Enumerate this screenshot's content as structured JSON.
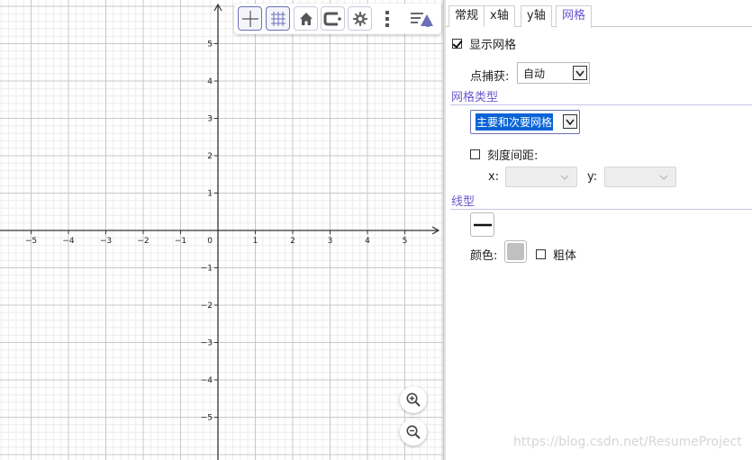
{
  "graph": {
    "x_ticks": [
      "−5",
      "−4",
      "−3",
      "−2",
      "−1",
      "1",
      "2",
      "3",
      "4",
      "5"
    ],
    "y_ticks": [
      "5",
      "4",
      "3",
      "2",
      "1",
      "−1",
      "−2",
      "−3",
      "−4",
      "−5"
    ],
    "origin_label": "0",
    "grid_type": "major-and-minor",
    "axis_color": "#333333",
    "major_grid_color": "#c8c8c8",
    "minor_grid_color": "#ececec"
  },
  "toolbar": {
    "axes_icon": "axes-toggle-icon",
    "grid_icon": "grid-toggle-icon",
    "home_icon": "home-icon",
    "point_capture_icon": "point-capture-icon",
    "settings_icon": "gear-icon",
    "more_icon": "more-vertical-icon",
    "style_bar_icon": "style-bar-toggle-icon"
  },
  "zoom": {
    "zoom_in_icon": "zoom-in-icon",
    "zoom_out_icon": "zoom-out-icon"
  },
  "panel": {
    "tabs": [
      {
        "label": "常规",
        "active": false
      },
      {
        "label": "x轴",
        "active": false
      },
      {
        "label": "y轴",
        "active": false
      },
      {
        "label": "网格",
        "active": true
      }
    ],
    "show_grid": {
      "label": "显示网格",
      "checked": true
    },
    "point_capture": {
      "label": "点捕获:",
      "value": "自动"
    },
    "grid_type_section": "网格类型",
    "grid_type_select": {
      "value": "主要和次要网格"
    },
    "tick_distance": {
      "label": "刻度间距:",
      "checked": false
    },
    "x_label": "x:",
    "y_label": "y:",
    "line_style_section": "线型",
    "color_label": "颜色:",
    "color_value": "#c0c0c0",
    "bold": {
      "label": "粗体",
      "checked": false
    }
  },
  "accent_color": "#6557d2",
  "watermark": "https://blog.csdn.net/ResumeProject"
}
